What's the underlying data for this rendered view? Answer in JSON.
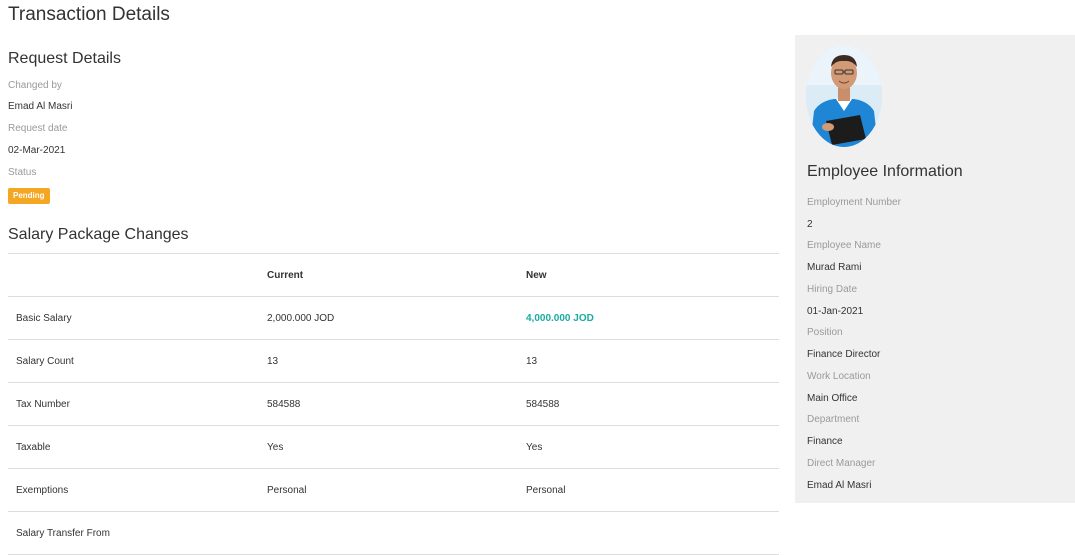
{
  "page": {
    "title": "Transaction Details"
  },
  "request": {
    "title": "Request Details",
    "changed_by_label": "Changed by",
    "changed_by_value": "Emad Al Masri",
    "request_date_label": "Request date",
    "request_date_value": "02-Mar-2021",
    "status_label": "Status",
    "status_value": "Pending"
  },
  "salary": {
    "title": "Salary Package Changes",
    "headers": [
      "",
      "Current",
      "New"
    ],
    "rows": [
      {
        "label": "Basic Salary",
        "current": "2,000.000 JOD",
        "new": "4,000.000 JOD"
      },
      {
        "label": "Salary Count",
        "current": "13",
        "new": "13"
      },
      {
        "label": "Tax Number",
        "current": "584588",
        "new": "584588"
      },
      {
        "label": "Taxable",
        "current": "Yes",
        "new": "Yes"
      },
      {
        "label": "Exemptions",
        "current": "Personal",
        "new": "Personal"
      },
      {
        "label": "Salary Transfer From",
        "current": "",
        "new": ""
      }
    ]
  },
  "employee": {
    "title": "Employee Information",
    "employment_number_label": "Employment Number",
    "employment_number_value": "2",
    "employee_name_label": "Employee Name",
    "employee_name_value": "Murad Rami",
    "hiring_date_label": "Hiring Date",
    "hiring_date_value": "01-Jan-2021",
    "position_label": "Position",
    "position_value": "Finance Director",
    "work_location_label": "Work Location",
    "work_location_value": "Main Office",
    "department_label": "Department",
    "department_value": "Finance",
    "direct_manager_label": "Direct Manager",
    "direct_manager_value": "Emad Al Masri"
  },
  "colors": {
    "status_pending": "#f5a623",
    "changed_value": "#1aaba0",
    "side_panel_bg": "#f0f0f0"
  }
}
